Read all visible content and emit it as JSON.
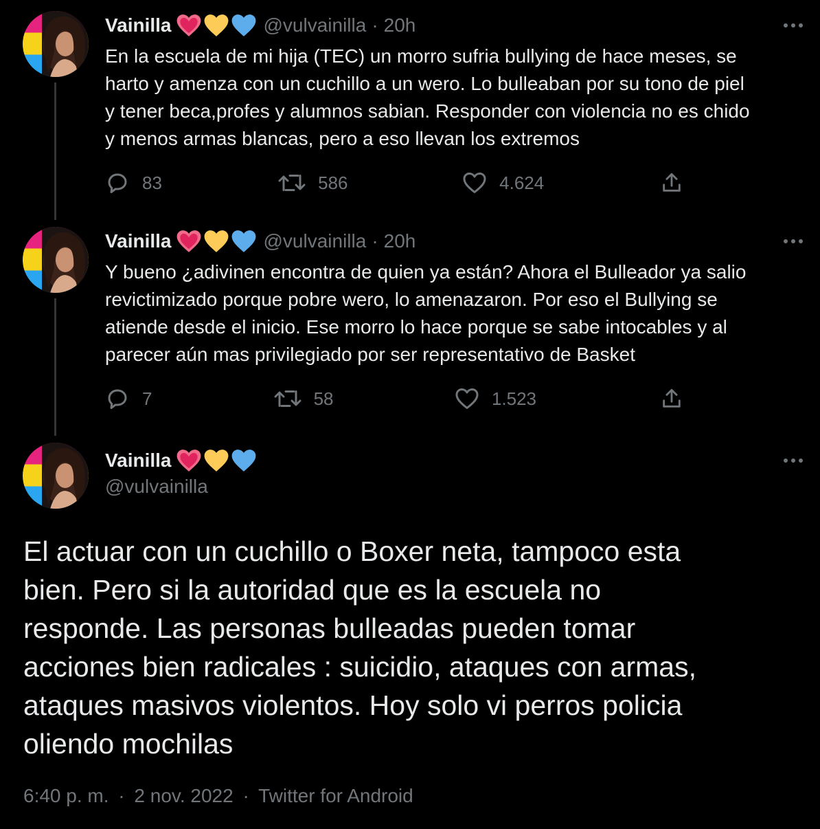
{
  "colors": {
    "background": "#000000",
    "text": "#e7e9ea",
    "muted": "#71767b",
    "thread_line": "#333639"
  },
  "tweets": [
    {
      "name": "Vainilla",
      "emojis": [
        "pink-heart-icon",
        "yellow-heart-icon",
        "blue-heart-icon"
      ],
      "handle": "@vulvainilla",
      "separator": "·",
      "time": "20h",
      "text": "En la escuela de mi hija (TEC) un morro sufria bullying de hace meses, se\nharto y amenza con un cuchillo a un wero. Lo bulleaban por su tono de piel\ny tener beca,profes y alumnos sabian. Responder con violencia no es chido\ny menos armas blancas, pero a eso llevan los extremos",
      "replies": "83",
      "retweets": "586",
      "likes": "4.624"
    },
    {
      "name": "Vainilla",
      "emojis": [
        "pink-heart-icon",
        "yellow-heart-icon",
        "blue-heart-icon"
      ],
      "handle": "@vulvainilla",
      "separator": "·",
      "time": "20h",
      "text": "Y bueno ¿adivinen encontra de quien ya están? Ahora el Bulleador ya salio\nrevictimizado porque pobre wero, lo amenazaron. Por eso el Bullying se\natiende desde el inicio. Ese morro lo hace porque se sabe intocables y al\nparecer aún mas privilegiado por ser representativo de Basket",
      "replies": "7",
      "retweets": "58",
      "likes": "1.523"
    }
  ],
  "main_tweet": {
    "name": "Vainilla",
    "emojis": [
      "pink-heart-icon",
      "yellow-heart-icon",
      "blue-heart-icon"
    ],
    "handle": "@vulvainilla",
    "text": "El actuar con un cuchillo o Boxer neta, tampoco esta\nbien. Pero si la autoridad que es la escuela no\nresponde. Las personas bulleadas pueden tomar\nacciones bien radicales : suicidio, ataques con armas,\nataques masivos violentos. Hoy solo vi perros policia\noliendo mochilas",
    "time": "6:40 p. m.",
    "date": "2 nov. 2022",
    "source": "Twitter for Android",
    "separator": "·"
  }
}
